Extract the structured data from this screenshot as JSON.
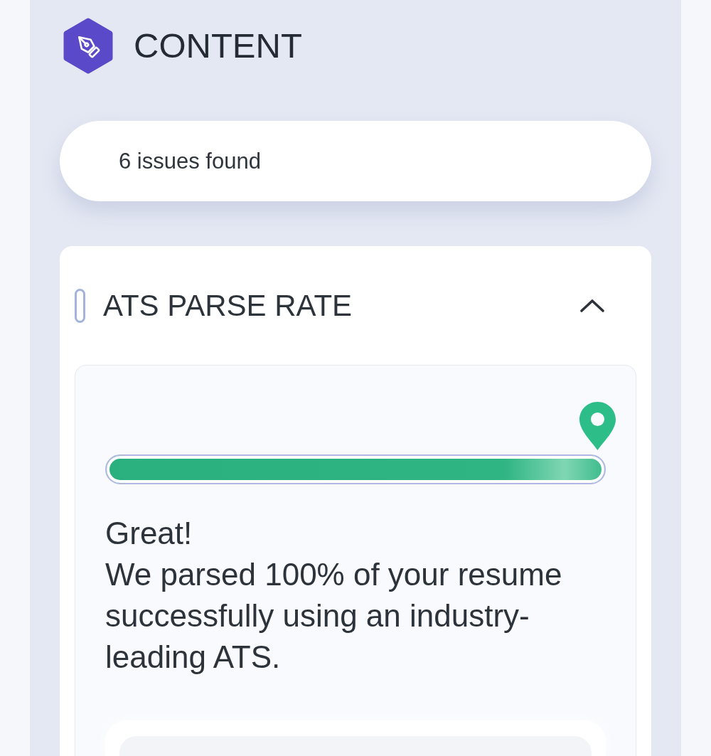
{
  "header": {
    "title": "CONTENT"
  },
  "summary": {
    "text": "6 issues found"
  },
  "sections": [
    {
      "title": "ATS PARSE RATE",
      "expanded": true,
      "level": 1,
      "headline": "Great!",
      "message": "We parsed 100% of your resume successfully using an industry-leading ATS."
    }
  ]
}
